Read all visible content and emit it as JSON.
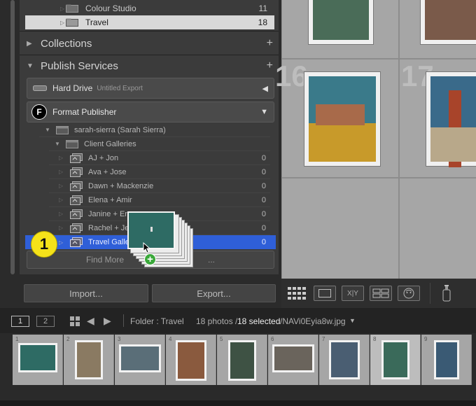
{
  "folders": [
    {
      "name": "Colour Studio",
      "count": "11"
    },
    {
      "name": "Travel",
      "count": "18"
    }
  ],
  "sections": {
    "collections": "Collections",
    "publish_services": "Publish Services"
  },
  "services": {
    "hard_drive": {
      "name": "Hard Drive",
      "sub": "Untitled Export"
    },
    "format_publisher": {
      "name": "Format Publisher",
      "logo": "F"
    }
  },
  "account": "sarah-sierra (Sarah Sierra)",
  "client_galleries": "Client Galleries",
  "galleries": [
    {
      "name": "AJ + Jon",
      "count": "0"
    },
    {
      "name": "Ava + Jose",
      "count": "0"
    },
    {
      "name": "Dawn + Mackenzie",
      "count": "0"
    },
    {
      "name": "Elena + Amir",
      "count": "0"
    },
    {
      "name": "Janine + Er",
      "count": "0"
    },
    {
      "name": "Rachel + Je",
      "count": "0"
    },
    {
      "name": "Travel Galle",
      "count": "0"
    }
  ],
  "find_more": "Find More",
  "find_more_tail": "...",
  "step_badge": "1",
  "buttons": {
    "import": "Import...",
    "export": "Export..."
  },
  "grid": {
    "cell_numbers": [
      "16",
      "17"
    ]
  },
  "toolbar": {
    "xy": "X|Y"
  },
  "filmstrip_bar": {
    "view1": "1",
    "view2": "2",
    "folder": "Folder : Travel",
    "photos": "18 photos /",
    "selected": "18 selected",
    "filename": "/NAVi0Eyia8w.jpg"
  },
  "filmstrip": [
    {
      "num": "1",
      "color": "#2e6b64"
    },
    {
      "num": "2",
      "color": "#8a7a62"
    },
    {
      "num": "3",
      "color": "#5a6e78"
    },
    {
      "num": "4",
      "color": "#8a5a3e"
    },
    {
      "num": "5",
      "color": "#3e5244"
    },
    {
      "num": "6",
      "color": "#6a645c"
    },
    {
      "num": "7",
      "color": "#4a5e72"
    },
    {
      "num": "8",
      "color": "#3a6a5a"
    },
    {
      "num": "9",
      "color": "#3a5a74"
    }
  ],
  "colors": {
    "selection_blue": "#2f5fd8",
    "badge_yellow": "#f5e21a",
    "add_green": "#3aa83a"
  }
}
